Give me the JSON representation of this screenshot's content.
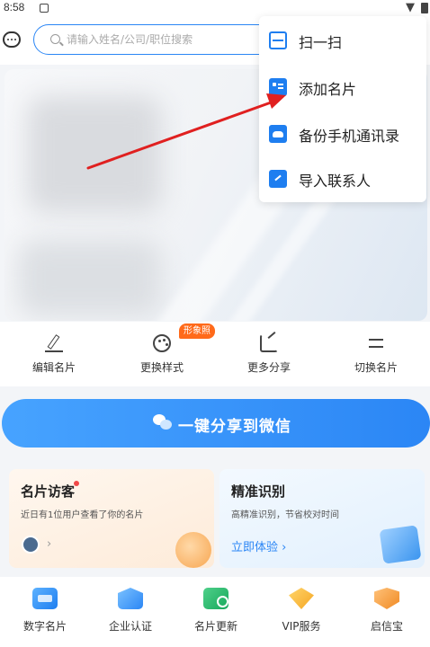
{
  "status": {
    "time": "8:58"
  },
  "search": {
    "placeholder": "请输入姓名/公司/职位搜索"
  },
  "menu": {
    "items": [
      {
        "label": "扫一扫",
        "icon": "scan-icon"
      },
      {
        "label": "添加名片",
        "icon": "add-card-icon"
      },
      {
        "label": "备份手机通讯录",
        "icon": "cloud-backup-icon"
      },
      {
        "label": "导入联系人",
        "icon": "import-icon"
      }
    ]
  },
  "actions": {
    "items": [
      {
        "label": "编辑名片",
        "icon": "edit-pen-icon"
      },
      {
        "label": "更换样式",
        "icon": "palette-icon"
      },
      {
        "label": "更多分享",
        "icon": "share-icon"
      },
      {
        "label": "切换名片",
        "icon": "swap-icon"
      }
    ],
    "badge": "形象照"
  },
  "share_button": {
    "label": "一键分享到微信",
    "icon": "wechat-icon"
  },
  "panels": {
    "visitors": {
      "title": "名片访客",
      "subtitle": "近日有1位用户查看了你的名片"
    },
    "recognition": {
      "title": "精准识别",
      "subtitle": "高精准识别，节省校对时间",
      "link": "立即体验 ›"
    }
  },
  "tabbar": {
    "items": [
      {
        "label": "数字名片",
        "icon": "digital-card-icon"
      },
      {
        "label": "企业认证",
        "icon": "enterprise-icon"
      },
      {
        "label": "名片更新",
        "icon": "card-update-icon"
      },
      {
        "label": "VIP服务",
        "icon": "vip-icon"
      },
      {
        "label": "启信宝",
        "icon": "qixinbao-icon"
      }
    ]
  },
  "colors": {
    "accent": "#2b86f5",
    "badge": "#ff6a1a",
    "annotation_arrow": "#e02020"
  }
}
